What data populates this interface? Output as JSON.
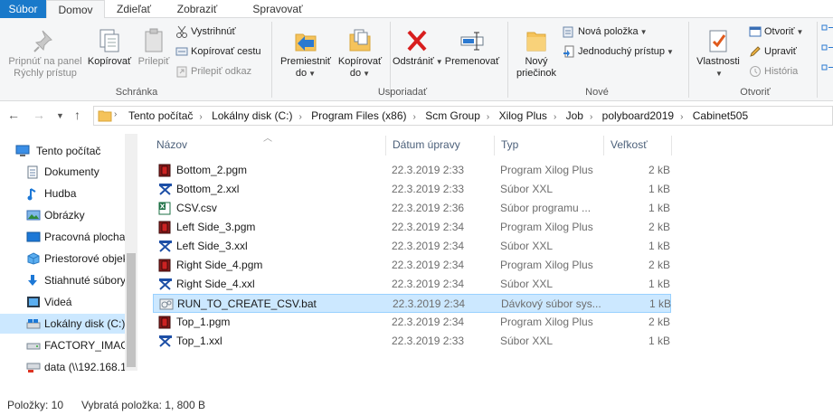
{
  "tabs": [
    "Súbor",
    "Domov",
    "Zdieľať",
    "Zobraziť",
    "Spravovať"
  ],
  "ribbon": {
    "clipboard": {
      "label": "Schránka",
      "pin_line1": "Pripnúť na panel",
      "pin_line2": "Rýchly prístup",
      "copy": "Kopírovať",
      "paste": "Prilepiť",
      "cut": "Vystrihnúť",
      "copy_path": "Kopírovať cestu",
      "paste_shortcut": "Prilepiť odkaz"
    },
    "organize": {
      "label": "Usporiadať",
      "move_line1": "Premiestniť",
      "move_line2": "do",
      "copyto_line1": "Kopírovať",
      "copyto_line2": "do",
      "delete": "Odstrániť",
      "rename": "Premenovať"
    },
    "new": {
      "label": "Nové",
      "folder_line1": "Nový",
      "folder_line2": "priečinok",
      "new_item": "Nová položka",
      "easy_access": "Jednoduchý prístup"
    },
    "open": {
      "label": "Otvoriť",
      "properties": "Vlastnosti",
      "open": "Otvoriť",
      "edit": "Upraviť",
      "history": "História"
    }
  },
  "breadcrumbs": [
    "Tento počítač",
    "Lokálny disk (C:)",
    "Program Files (x86)",
    "Scm Group",
    "Xilog Plus",
    "Job",
    "polyboard2019",
    "Cabinet505"
  ],
  "sidebar": {
    "items": [
      {
        "label": "Tento počítač",
        "icon": "computer-icon"
      },
      {
        "label": "Dokumenty",
        "icon": "documents-icon"
      },
      {
        "label": "Hudba",
        "icon": "music-icon"
      },
      {
        "label": "Obrázky",
        "icon": "pictures-icon"
      },
      {
        "label": "Pracovná plocha",
        "icon": "desktop-icon"
      },
      {
        "label": "Priestorové objekty",
        "icon": "3d-objects-icon"
      },
      {
        "label": "Stiahnuté súbory",
        "icon": "downloads-icon"
      },
      {
        "label": "Videá",
        "icon": "videos-icon"
      },
      {
        "label": "Lokálny disk (C:)",
        "icon": "local-disk-icon"
      },
      {
        "label": "FACTORY_IMAGE",
        "icon": "drive-icon"
      },
      {
        "label": "data (\\\\192.168.1",
        "icon": "network-drive-icon"
      }
    ]
  },
  "columns": {
    "name": "Názov",
    "date": "Dátum úpravy",
    "type": "Typ",
    "size": "Veľkosť"
  },
  "files": [
    {
      "name": "Bottom_2.pgm",
      "date": "22.3.2019 2:33",
      "type": "Program Xilog Plus",
      "size": "2 kB",
      "icon": "pgm-file-icon"
    },
    {
      "name": "Bottom_2.xxl",
      "date": "22.3.2019 2:33",
      "type": "Súbor XXL",
      "size": "1 kB",
      "icon": "xxl-file-icon"
    },
    {
      "name": "CSV.csv",
      "date": "22.3.2019 2:36",
      "type": "Súbor programu ...",
      "size": "1 kB",
      "icon": "csv-file-icon"
    },
    {
      "name": "Left Side_3.pgm",
      "date": "22.3.2019 2:34",
      "type": "Program Xilog Plus",
      "size": "2 kB",
      "icon": "pgm-file-icon"
    },
    {
      "name": "Left Side_3.xxl",
      "date": "22.3.2019 2:34",
      "type": "Súbor XXL",
      "size": "1 kB",
      "icon": "xxl-file-icon"
    },
    {
      "name": "Right Side_4.pgm",
      "date": "22.3.2019 2:34",
      "type": "Program Xilog Plus",
      "size": "2 kB",
      "icon": "pgm-file-icon"
    },
    {
      "name": "Right Side_4.xxl",
      "date": "22.3.2019 2:34",
      "type": "Súbor XXL",
      "size": "1 kB",
      "icon": "xxl-file-icon"
    },
    {
      "name": "RUN_TO_CREATE_CSV.bat",
      "date": "22.3.2019 2:34",
      "type": "Dávkový súbor sys...",
      "size": "1 kB",
      "icon": "bat-file-icon"
    },
    {
      "name": "Top_1.pgm",
      "date": "22.3.2019 2:34",
      "type": "Program Xilog Plus",
      "size": "2 kB",
      "icon": "pgm-file-icon"
    },
    {
      "name": "Top_1.xxl",
      "date": "22.3.2019 2:33",
      "type": "Súbor XXL",
      "size": "1 kB",
      "icon": "xxl-file-icon"
    }
  ],
  "status": {
    "count": "Položky: 10",
    "selected": "Vybratá položka: 1, 800 B"
  }
}
